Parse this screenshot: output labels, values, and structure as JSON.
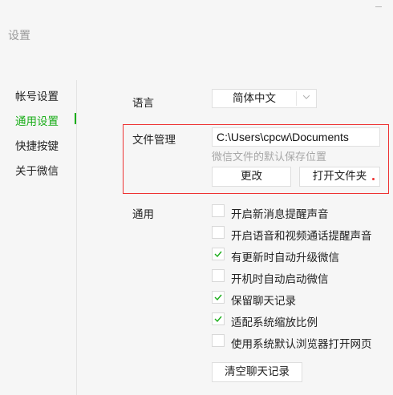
{
  "window": {
    "title": "设置"
  },
  "sidebar": {
    "items": [
      {
        "label": "帐号设置",
        "active": false
      },
      {
        "label": "通用设置",
        "active": true
      },
      {
        "label": "快捷按键",
        "active": false
      },
      {
        "label": "关于微信",
        "active": false
      }
    ]
  },
  "language": {
    "label": "语言",
    "value": "简体中文"
  },
  "file_management": {
    "label": "文件管理",
    "path": "C:\\Users\\cpcw\\Documents",
    "hint": "微信文件的默认保存位置",
    "change_button": "更改",
    "open_folder_button": "打开文件夹"
  },
  "general": {
    "label": "通用",
    "options": [
      {
        "label": "开启新消息提醒声音",
        "checked": false
      },
      {
        "label": "开启语音和视频通话提醒声音",
        "checked": false
      },
      {
        "label": "有更新时自动升级微信",
        "checked": true
      },
      {
        "label": "开机时自动启动微信",
        "checked": false
      },
      {
        "label": "保留聊天记录",
        "checked": true
      },
      {
        "label": "适配系统缩放比例",
        "checked": true
      },
      {
        "label": "使用系统默认浏览器打开网页",
        "checked": false
      }
    ],
    "clear_button": "清空聊天记录"
  },
  "colors": {
    "accent": "#1aad19",
    "highlight": "#e33333",
    "hint": "#a7a7a7"
  }
}
